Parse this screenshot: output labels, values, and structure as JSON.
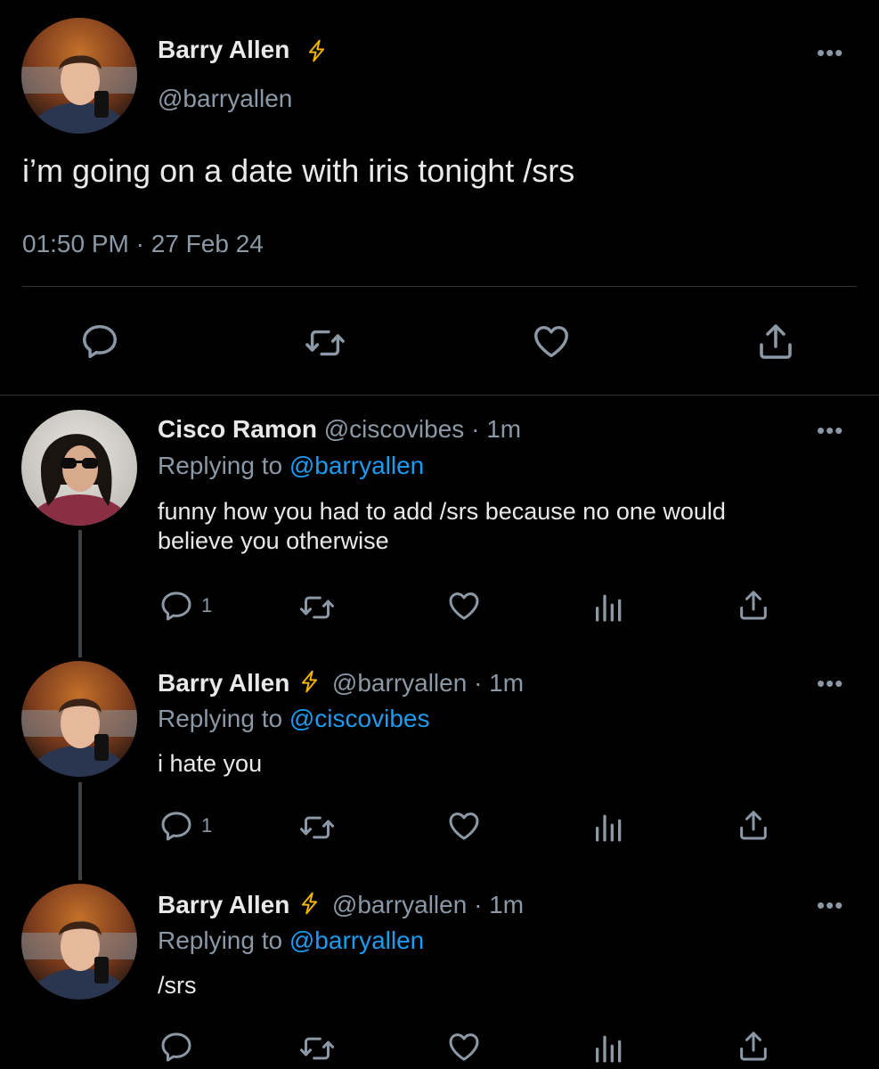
{
  "main_tweet": {
    "name": "Barry Allen",
    "handle": "@barryallen",
    "text": "i’m going on a date with iris tonight /srs",
    "time": "01:50 PM",
    "date_sep": "·",
    "date": "27 Feb 24"
  },
  "replies": [
    {
      "name": "Cisco Ramon",
      "handle": "@ciscovibes",
      "time": "· 1m",
      "replying_prefix": "Replying to",
      "replying_to": "@barryallen",
      "text_line1": "funny how you had to add /srs because no one would",
      "text_line2": "believe you otherwise",
      "reply_count": "1"
    },
    {
      "name": "Barry Allen",
      "handle": "@barryallen",
      "time": "· 1m",
      "replying_prefix": "Replying to",
      "replying_to": "@ciscovibes",
      "text": "i hate you",
      "reply_count": "1"
    },
    {
      "name": "Barry Allen",
      "handle": "@barryallen",
      "time": "· 1m",
      "replying_prefix": "Replying to",
      "replying_to": "@barryallen",
      "text": "/srs"
    }
  ],
  "icons": {
    "verified": "lightning-bolt-icon",
    "more": "more-options-icon",
    "reply": "speech-bubble-icon",
    "retweet": "retweet-arrows-icon",
    "like": "heart-icon",
    "analytics": "bar-chart-icon",
    "share": "share-upload-icon"
  },
  "colors": {
    "background": "#000000",
    "text": "#e7e9ea",
    "muted": "#8b98a5",
    "link": "#1d9bf0",
    "bolt": "#f2b600"
  }
}
